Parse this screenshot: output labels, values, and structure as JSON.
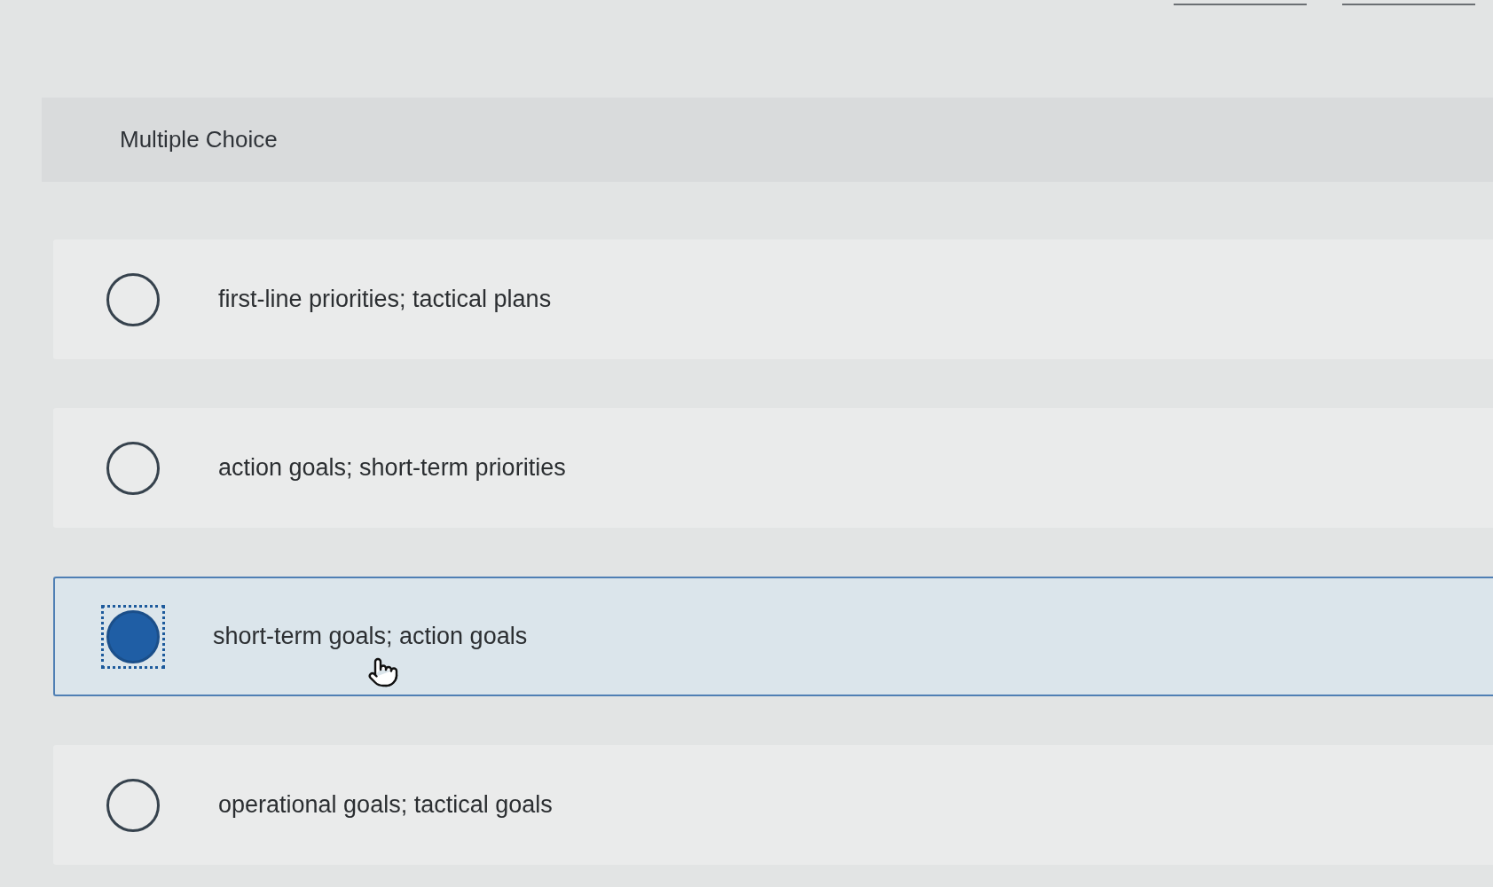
{
  "section": {
    "title": "Multiple Choice"
  },
  "options": [
    {
      "label": "first-line priorities; tactical plans",
      "selected": false
    },
    {
      "label": "action goals; short-term priorities",
      "selected": false
    },
    {
      "label": "short-term goals; action goals",
      "selected": true
    },
    {
      "label": "operational goals; tactical goals",
      "selected": false
    }
  ]
}
